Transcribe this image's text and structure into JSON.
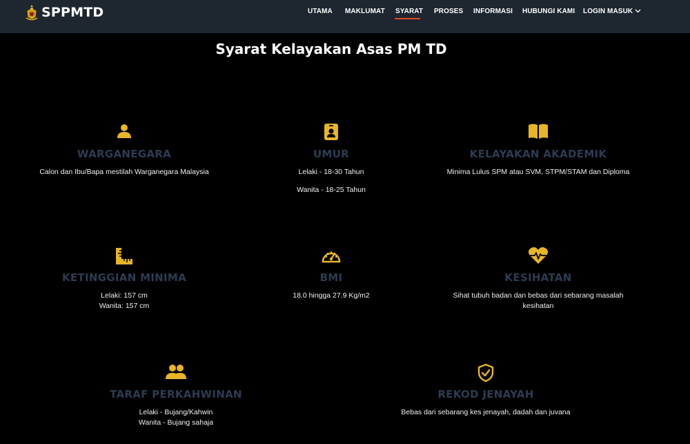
{
  "brand": {
    "name": "SPPMTD"
  },
  "nav": {
    "items": [
      {
        "label": "UTAMA"
      },
      {
        "label": "MAKLUMAT"
      },
      {
        "label": "SYARAT"
      },
      {
        "label": "PROSES"
      },
      {
        "label": "INFORMASI"
      },
      {
        "label": "HUBUNGI KAMI"
      },
      {
        "label": "LOGIN MASUK"
      }
    ],
    "active_index": 2
  },
  "page": {
    "title": "Syarat Kelayakan Asas PM TD"
  },
  "colors": {
    "accent": "#e8b527",
    "heading": "#2d3c52",
    "nav_bg": "#1e2630",
    "underline": "#e6472a"
  },
  "cards": [
    {
      "icon": "user-icon",
      "title": "WARGANEGARA",
      "lines": [
        "Calon dan Ibu/Bapa mestilah Warganegara Malaysia"
      ]
    },
    {
      "icon": "id-badge-icon",
      "title": "UMUR",
      "lines": [
        "Lelaki - 18-30 Tahun",
        "Wanita - 18-25 Tahun"
      ]
    },
    {
      "icon": "book-icon",
      "title": "KELAYAKAN AKADEMIK",
      "lines": [
        "Minima Lulus SPM atau SVM, STPM/STAM dan Diploma"
      ]
    },
    {
      "icon": "ruler-icon",
      "title": "KETINGGIAN MINIMA",
      "lines": [
        "Lelaki: 157 cm",
        "Wanita: 157 cm"
      ]
    },
    {
      "icon": "gauge-icon",
      "title": "BMI",
      "lines": [
        "18.0 hingga 27.9 Kg/m2"
      ]
    },
    {
      "icon": "heart-pulse-icon",
      "title": "KESIHATAN",
      "lines": [
        "Sihat tubuh badan dan bebas dari sebarang masalah",
        "kesihatan"
      ]
    },
    {
      "icon": "users-icon",
      "title": "TARAF PERKAHWINAN",
      "lines": [
        "Lelaki - Bujang/Kahwin",
        "Wanita - Bujang sahaja"
      ]
    },
    {
      "icon": "shield-check-icon",
      "title": "REKOD JENAYAH",
      "lines": [
        "Bebas dari sebarang kes jenayah, dadah dan juvana"
      ]
    }
  ]
}
